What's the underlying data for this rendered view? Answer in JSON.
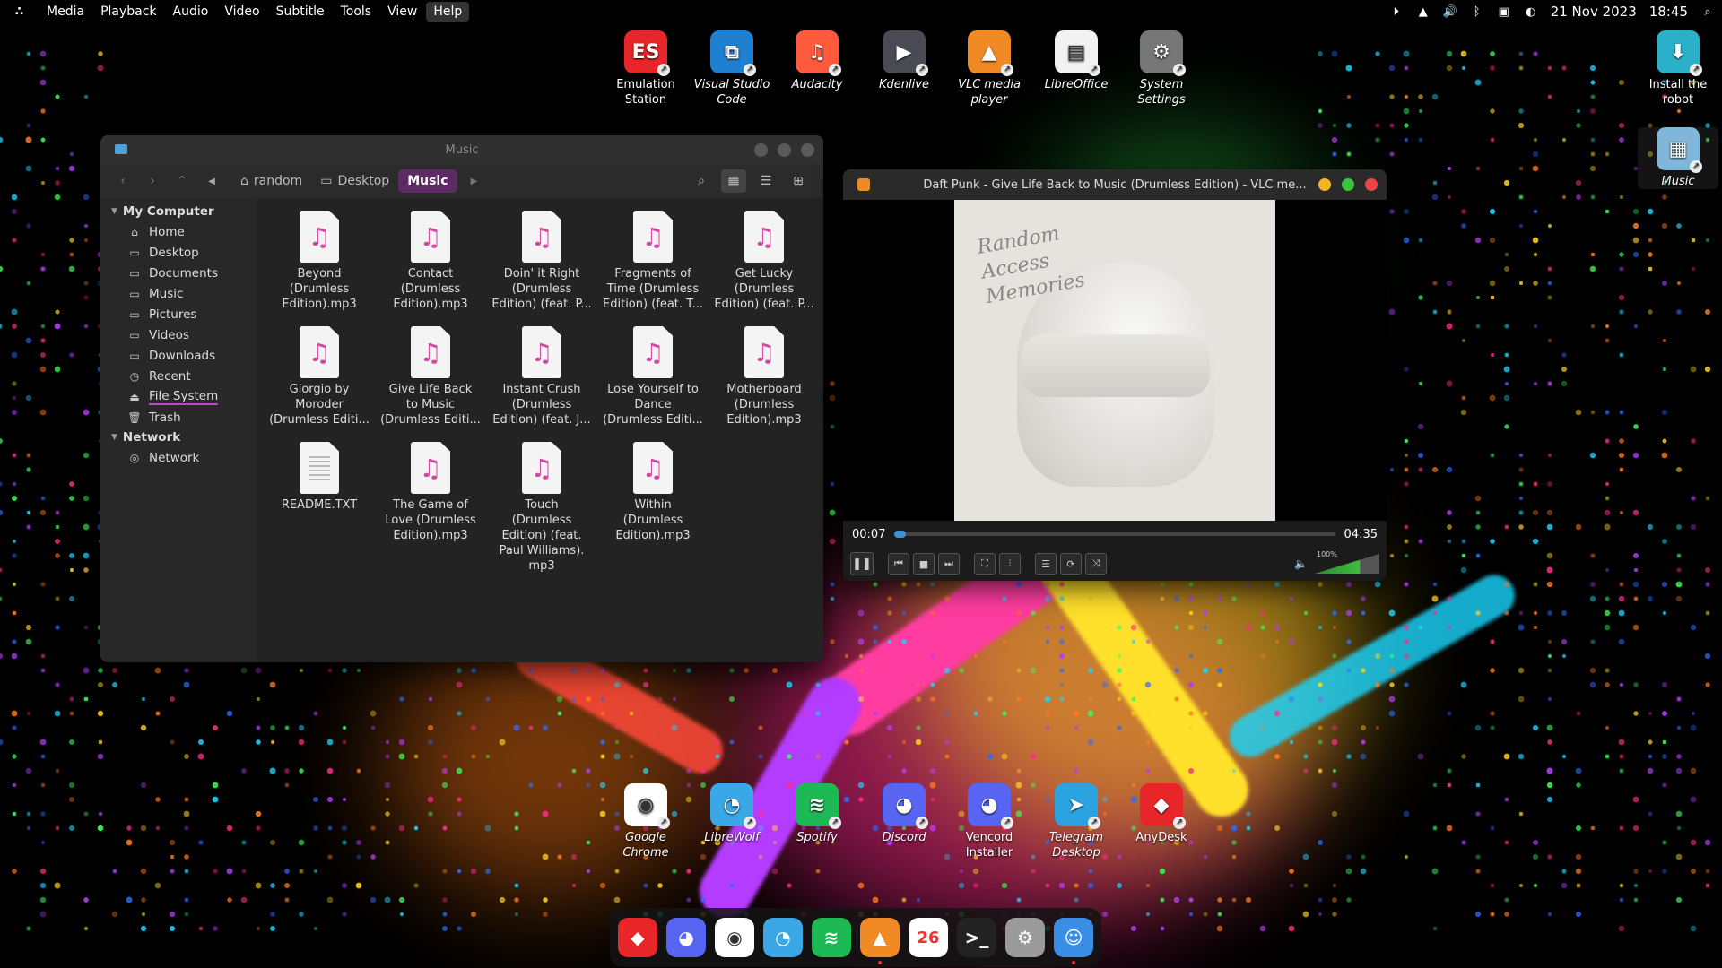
{
  "menubar": {
    "logo": "∴",
    "items": [
      "Media",
      "Playback",
      "Audio",
      "Video",
      "Subtitle",
      "Tools",
      "View",
      "Help"
    ],
    "active_index": 7,
    "tray_icons": [
      "play-circle-icon",
      "vlc-cone-icon",
      "volume-icon",
      "bluetooth-icon",
      "screen-icon",
      "toggle-icon",
      "search-icon"
    ],
    "date": "21 Nov 2023",
    "time": "18:45"
  },
  "desktop_top": [
    {
      "name": "Emulation\nStation",
      "icon": "emulationstation-icon",
      "glyph": "ES",
      "color": "#e8262a",
      "italic": false
    },
    {
      "name": "Visual Studio\nCode",
      "icon": "vscode-icon",
      "glyph": "⧉",
      "color": "#1f7fd1",
      "italic": true
    },
    {
      "name": "Audacity",
      "icon": "audacity-icon",
      "glyph": "♫",
      "color": "#ff5a3c",
      "italic": true
    },
    {
      "name": "Kdenlive",
      "icon": "kdenlive-icon",
      "glyph": "▶",
      "color": "#4a4a55",
      "italic": true
    },
    {
      "name": "VLC media\nplayer",
      "icon": "vlc-icon",
      "glyph": "▲",
      "color": "#f08a24",
      "italic": true
    },
    {
      "name": "LibreOffice",
      "icon": "libreoffice-icon",
      "glyph": "▤",
      "color": "#f2f2f2",
      "italic": true
    },
    {
      "name": "System\nSettings",
      "icon": "system-settings-icon",
      "glyph": "⚙",
      "color": "#777777",
      "italic": true
    }
  ],
  "desktop_right": [
    {
      "name": "Install the\nrobot",
      "icon": "install-robot-icon",
      "glyph": "⬇",
      "color": "#2ab0c8"
    },
    {
      "name": "Music",
      "icon": "music-folder-icon",
      "glyph": "▦",
      "color": "#7fb6d9"
    }
  ],
  "desktop_bottom": [
    {
      "name": "Google\nChrome",
      "icon": "chrome-icon",
      "glyph": "◉",
      "color": "#ffffff",
      "italic": true
    },
    {
      "name": "LibreWolf",
      "icon": "librewolf-icon",
      "glyph": "◔",
      "color": "#3aa7e6",
      "italic": true
    },
    {
      "name": "Spotify",
      "icon": "spotify-icon",
      "glyph": "≋",
      "color": "#1db954",
      "italic": true
    },
    {
      "name": "Discord",
      "icon": "discord-icon",
      "glyph": "◕",
      "color": "#5865f2",
      "italic": true
    },
    {
      "name": "Vencord\nInstaller",
      "icon": "vencord-icon",
      "glyph": "◕",
      "color": "#5865f2",
      "italic": false
    },
    {
      "name": "Telegram\nDesktop",
      "icon": "telegram-icon",
      "glyph": "➤",
      "color": "#2aa3e0",
      "italic": true
    },
    {
      "name": "AnyDesk",
      "icon": "anydesk-icon",
      "glyph": "◆",
      "color": "#e8262a",
      "italic": false
    }
  ],
  "file_manager": {
    "title": "Music",
    "breadcrumbs": [
      "random",
      "Desktop",
      "Music"
    ],
    "sidebar": {
      "my_computer": "My Computer",
      "places": [
        {
          "label": "Home",
          "icon": "home-icon",
          "glyph": "⌂"
        },
        {
          "label": "Desktop",
          "icon": "desktop-icon",
          "glyph": "▭"
        },
        {
          "label": "Documents",
          "icon": "folder-icon",
          "glyph": "▭"
        },
        {
          "label": "Music",
          "icon": "folder-icon",
          "glyph": "▭"
        },
        {
          "label": "Pictures",
          "icon": "folder-icon",
          "glyph": "▭"
        },
        {
          "label": "Videos",
          "icon": "folder-icon",
          "glyph": "▭"
        },
        {
          "label": "Downloads",
          "icon": "folder-icon",
          "glyph": "▭"
        },
        {
          "label": "Recent",
          "icon": "clock-icon",
          "glyph": "◷"
        },
        {
          "label": "File System",
          "icon": "drive-icon",
          "glyph": "⏏"
        },
        {
          "label": "Trash",
          "icon": "trash-icon",
          "glyph": "🗑"
        }
      ],
      "network_section": "Network",
      "network_items": [
        {
          "label": "Network",
          "icon": "globe-icon",
          "glyph": "◎"
        }
      ]
    },
    "files": [
      {
        "name": "Beyond\n(Drumless\nEdition).mp3",
        "type": "audio"
      },
      {
        "name": "Contact\n(Drumless\nEdition).mp3",
        "type": "audio"
      },
      {
        "name": "Doin' it Right\n(Drumless\nEdition) (feat. P...",
        "type": "audio"
      },
      {
        "name": "Fragments of\nTime (Drumless\nEdition) (feat. T...",
        "type": "audio"
      },
      {
        "name": "Get Lucky\n(Drumless\nEdition) (feat. P...",
        "type": "audio"
      },
      {
        "name": "Giorgio by\nMoroder\n(Drumless Editi...",
        "type": "audio"
      },
      {
        "name": "Give Life Back\nto Music\n(Drumless Editi...",
        "type": "audio"
      },
      {
        "name": "Instant Crush\n(Drumless\nEdition) (feat. J...",
        "type": "audio"
      },
      {
        "name": "Lose Yourself to\nDance\n(Drumless Editi...",
        "type": "audio"
      },
      {
        "name": "Motherboard\n(Drumless\nEdition).mp3",
        "type": "audio"
      },
      {
        "name": "README.TXT",
        "type": "text"
      },
      {
        "name": "The Game of\nLove (Drumless\nEdition).mp3",
        "type": "audio"
      },
      {
        "name": "Touch\n(Drumless\nEdition) (feat.\nPaul Williams).\nmp3",
        "type": "audio"
      },
      {
        "name": "Within\n(Drumless\nEdition).mp3",
        "type": "audio"
      }
    ]
  },
  "vlc": {
    "title": "Daft Punk - Give Life Back to Music (Drumless Edition) - VLC me...",
    "cover_text": "Random\nAccess\nMemories",
    "elapsed": "00:07",
    "duration": "04:35",
    "progress_fraction": 0.025,
    "volume_label": "100%",
    "volume_fraction": 0.7
  },
  "dock": [
    {
      "icon": "anydesk-icon",
      "glyph": "◆",
      "color": "#e8262a",
      "running": false
    },
    {
      "icon": "discord-icon",
      "glyph": "◕",
      "color": "#5865f2",
      "running": false
    },
    {
      "icon": "chrome-icon",
      "glyph": "◉",
      "color": "#ffffff",
      "running": false
    },
    {
      "icon": "librewolf-icon",
      "glyph": "◔",
      "color": "#3aa7e6",
      "running": false
    },
    {
      "icon": "spotify-icon",
      "glyph": "≋",
      "color": "#1db954",
      "running": false
    },
    {
      "icon": "vlc-icon",
      "glyph": "▲",
      "color": "#f08a24",
      "running": true
    },
    {
      "icon": "calendar-icon",
      "glyph": "26",
      "color": "#ffffff",
      "running": false
    },
    {
      "icon": "terminal-icon",
      "glyph": ">_",
      "color": "#222222",
      "running": false
    },
    {
      "icon": "settings-icon",
      "glyph": "⚙",
      "color": "#9a9a9a",
      "running": false
    },
    {
      "icon": "finder-icon",
      "glyph": "☺",
      "color": "#3a8ee6",
      "running": true
    }
  ]
}
